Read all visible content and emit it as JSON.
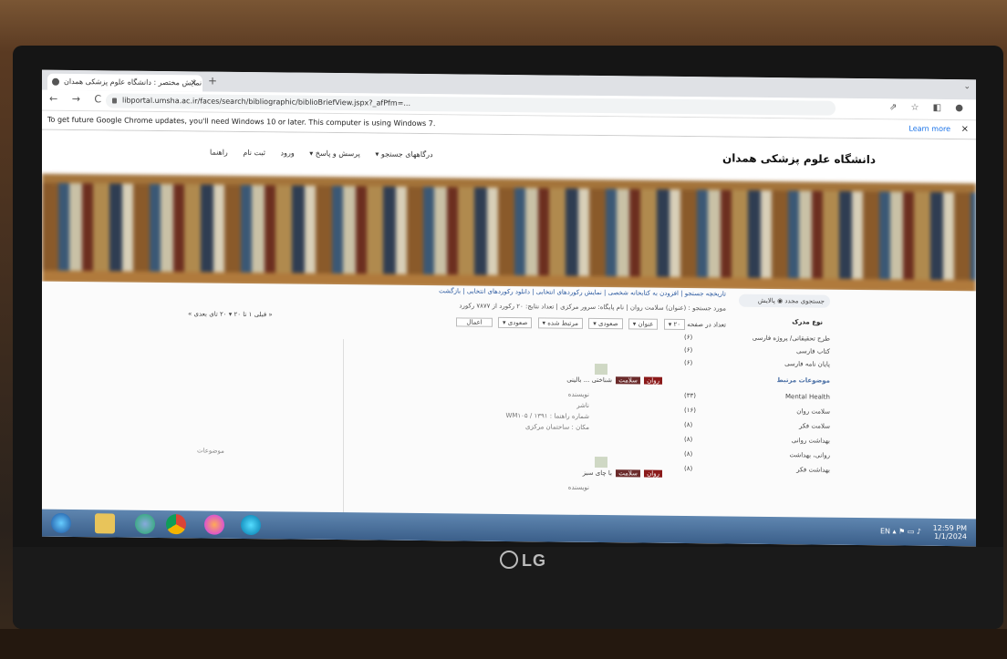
{
  "browser": {
    "tab_title": "نمایش مختصر : دانشگاه علوم پزشکی همدان",
    "tab_close": "×",
    "new_tab": "+",
    "window_controls": "⌄",
    "nav_buttons": "← → C",
    "url": "libportal.umsha.ac.ir/faces/search/bibliographic/biblioBriefView.jspx?_afPfm=...",
    "toolbar_icons": "⇗ ☆ ◧ ●",
    "info_message": "To get future Google Chrome updates, you'll need Windows 10 or later. This computer is using Windows 7.",
    "learn_more": "Learn more",
    "info_close": "×"
  },
  "site": {
    "title": "دانشگاه علوم پزشکی همدان",
    "menu": [
      "درگاههای جستجو ▾",
      "پرسش و پاسخ ▾",
      "ورود",
      "ثبت نام",
      "راهنما"
    ]
  },
  "sidebar": {
    "search_placeholder": "جستجوی مجدد",
    "search_scope": "پالایش",
    "doc_type_heading": "نوع مدرک",
    "doc_types": [
      {
        "label": "طرح تحقیقاتی/ پروژه فارسی",
        "count": "(۶)"
      },
      {
        "label": "کتاب فارسی",
        "count": "(۶)"
      },
      {
        "label": "پایان نامه فارسی",
        "count": "(۶)"
      }
    ],
    "related_heading": "موضوعات مرتبط",
    "related": [
      {
        "label": "Mental Health",
        "count": "(۳۳)"
      },
      {
        "label": "سلامت روان",
        "count": "(۱۶)"
      },
      {
        "label": "سلامت فکر",
        "count": "(۸)"
      },
      {
        "label": "بهداشت روانی",
        "count": "(۸)"
      },
      {
        "label": "روانی، بهداشت",
        "count": "(۸)"
      },
      {
        "label": "بهداشت فکر",
        "count": "(۸)"
      }
    ]
  },
  "main": {
    "toolbar_links": "تاریخچه جستجو | افزودن به کتابخانه شخصی | نمایش رکوردهای انتخابی | دانلود رکوردهای انتخابی | بازگشت",
    "result_meta": "مورد جستجو : (عنوان) سلامت روان | نام پایگاه: سرور مرکزی | تعداد نتایج: ۲۰ رکورد از ۷۸۷۷ رکورد",
    "sort_label": "تعداد در صفحه",
    "sort_selects": [
      "۲۰ ▾",
      "عنوان ▾",
      "صعودی ▾",
      "مرتبط شده ▾",
      "صعودی ▾"
    ],
    "apply_button": "اعمال",
    "pager": "« قبلی  ۱ تا ۲۰ ▾  ۲۰ تای بعدی »",
    "records": [
      {
        "tags": [
          "روان",
          "سلامت"
        ],
        "title_suffix": "شناختی ... بالینی",
        "lines": [
          "نویسنده",
          "ناشر",
          "شماره راهنما : ۱۳۹۱ / WM۱۰۵",
          "مکان : ساختمان مرکزی"
        ]
      },
      {
        "tags": [
          "روان",
          "سلامت"
        ],
        "title_suffix": "با چای سبز",
        "lines": [
          "نویسنده"
        ]
      }
    ],
    "side_note": "موضوعات"
  },
  "taskbar": {
    "clock_time": "12:59 PM",
    "clock_date": "1/1/2024",
    "tray": "EN ▴ ⚑ ▭ ♪"
  },
  "hardware": {
    "brand": "LG"
  }
}
